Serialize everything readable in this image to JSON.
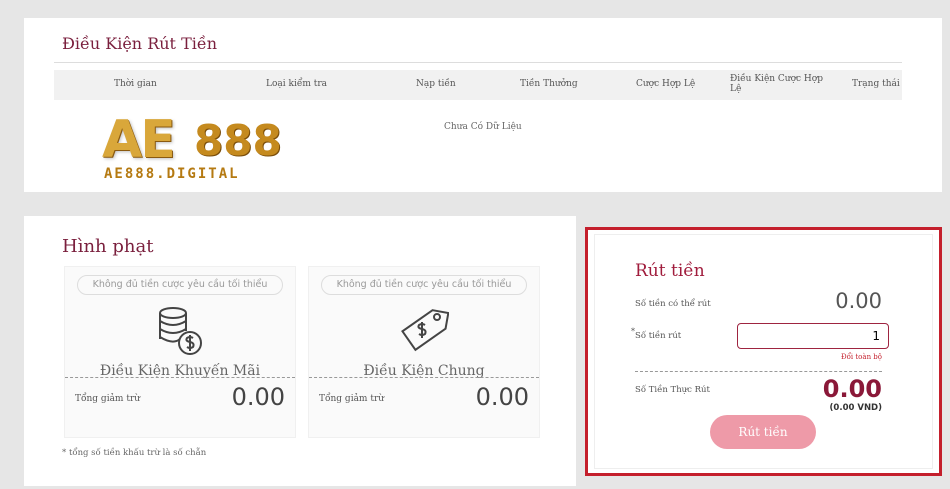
{
  "conditions": {
    "title": "Điều Kiện Rút Tiền",
    "columns": [
      "Thời gian",
      "Loại kiểm tra",
      "Nạp tiền",
      "Tiền Thưởng",
      "Cược Hợp Lệ",
      "Điều Kiện Cược Hợp Lệ",
      "Trạng thái"
    ],
    "empty_text": "Chưa Có Dữ Liệu"
  },
  "logo": {
    "main": "AE",
    "number": "888",
    "sub": "AE888.DIGITAL"
  },
  "penalty": {
    "title": "Hình phạt",
    "promo": {
      "notice": "Không đủ tiền cược yêu cầu tối thiểu",
      "label": "Điều Kiện Khuyến Mãi",
      "total_label": "Tổng giảm trừ",
      "total_value": "0.00",
      "icon": "coins-dollar-icon"
    },
    "general": {
      "notice": "Không đủ tiền cược yêu cầu tối thiểu",
      "label": "Điều Kiện Chung",
      "total_label": "Tổng giảm trừ",
      "total_value": "0.00",
      "icon": "price-tag-icon"
    },
    "footnote": "* tổng số tiền khấu trừ là số chẵn"
  },
  "withdraw": {
    "title": "Rút tiền",
    "available_label": "Số tiền có thể rút",
    "available_value": "0.00",
    "amount_star": "*",
    "amount_label": "Số tiền rút",
    "amount_value": "1",
    "change_all": "Đổi toàn bộ",
    "actual_label": "Số Tiền Thực Rút",
    "actual_value": "0.00",
    "actual_sub": "(0.00 VND)",
    "button": "Rút tiền",
    "colors": {
      "accent": "#c41f2c",
      "button": "#ee9aa8",
      "title": "#a01c3c"
    }
  }
}
